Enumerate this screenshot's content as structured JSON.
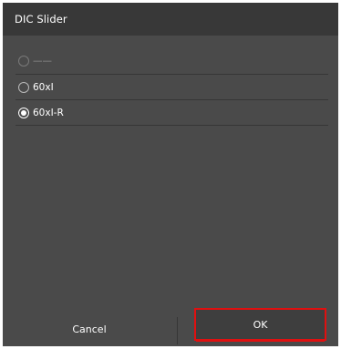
{
  "dialog": {
    "title": "DIC Slider"
  },
  "options": [
    {
      "label": "——",
      "selected": false,
      "disabled": true
    },
    {
      "label": "60xI",
      "selected": false,
      "disabled": false
    },
    {
      "label": "60xI-R",
      "selected": true,
      "disabled": false
    }
  ],
  "footer": {
    "cancel_label": "Cancel",
    "ok_label": "OK"
  },
  "colors": {
    "dialog_bg": "#4a4a4a",
    "title_bg": "#383838",
    "highlight": "#e01010"
  }
}
